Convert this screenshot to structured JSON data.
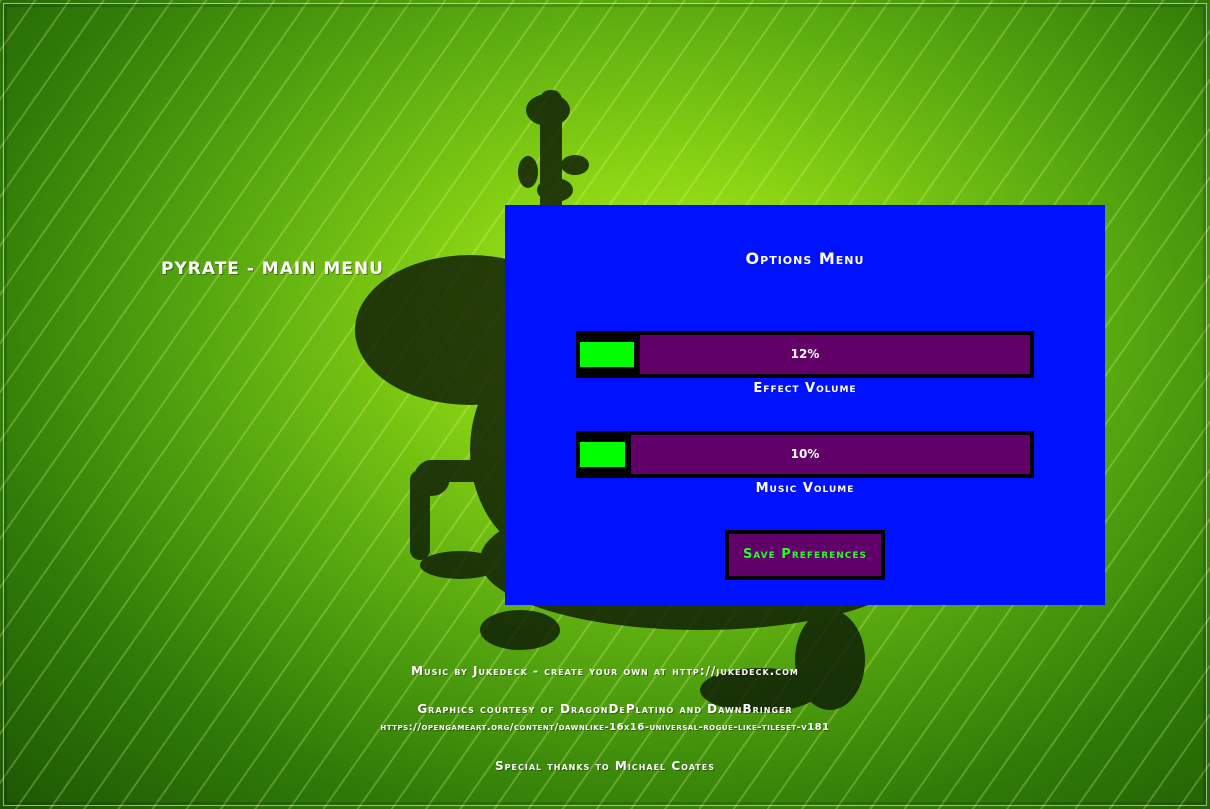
{
  "main_menu": {
    "title": "PYRATE - MAIN MENU"
  },
  "options_panel": {
    "title": "Options Menu",
    "background_color": "#0011ff",
    "effect_volume": {
      "value_percent": 12,
      "value_text": "12%",
      "label": "Effect Volume"
    },
    "music_volume": {
      "value_percent": 10,
      "value_text": "10%",
      "label": "Music Volume"
    },
    "save_button_label": "Save Preferences"
  },
  "credits": {
    "music": "Music by Jukedeck - create your own at http://jukedeck.com",
    "graphics": "Graphics courtesy of DragonDePlatino and DawnBringer",
    "graphics_url": "https://opengameart.org/content/dawnlike-16x16-universal-rogue-like-tileset-v181",
    "thanks": "Special thanks to Michael Coates"
  },
  "colors": {
    "slider_track": "#610068",
    "slider_knob": "#00ff00",
    "button_text": "#22ff22"
  },
  "background_icon": "tree-frog-silhouette-on-leaf"
}
